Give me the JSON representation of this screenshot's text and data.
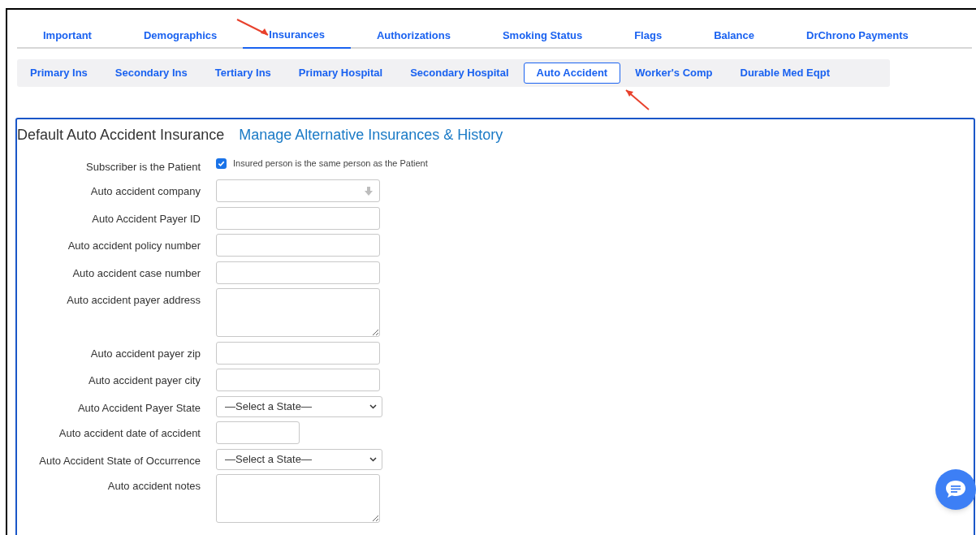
{
  "main_tabs": [
    {
      "label": "Important",
      "selected": false
    },
    {
      "label": "Demographics",
      "selected": false
    },
    {
      "label": "Insurances",
      "selected": true
    },
    {
      "label": "Authorizations",
      "selected": false
    },
    {
      "label": "Smoking Status",
      "selected": false
    },
    {
      "label": "Flags",
      "selected": false
    },
    {
      "label": "Balance",
      "selected": false
    },
    {
      "label": "DrChrono Payments",
      "selected": false
    }
  ],
  "sub_tabs": [
    {
      "label": "Primary Ins",
      "selected": false
    },
    {
      "label": "Secondary Ins",
      "selected": false
    },
    {
      "label": "Tertiary Ins",
      "selected": false
    },
    {
      "label": "Primary Hospital",
      "selected": false
    },
    {
      "label": "Secondary Hospital",
      "selected": false
    },
    {
      "label": "Auto Accident",
      "selected": true
    },
    {
      "label": "Worker's Comp",
      "selected": false
    },
    {
      "label": "Durable Med Eqpt",
      "selected": false
    }
  ],
  "form": {
    "title": "Default Auto Accident Insurance",
    "link": "Manage Alternative Insurances & History",
    "fields": [
      {
        "kind": "checkbox",
        "label": "Subscriber is the Patient",
        "checked": true,
        "text": "Insured person is the same person as the Patient"
      },
      {
        "kind": "combo",
        "label": "Auto accident company"
      },
      {
        "kind": "text",
        "label": "Auto Accident Payer ID"
      },
      {
        "kind": "text",
        "label": "Auto accident policy number"
      },
      {
        "kind": "text",
        "label": "Auto accident case number"
      },
      {
        "kind": "textarea",
        "label": "Auto accident payer address"
      },
      {
        "kind": "text",
        "label": "Auto accident payer zip"
      },
      {
        "kind": "text",
        "label": "Auto accident payer city"
      },
      {
        "kind": "select",
        "label": "Auto Accident Payer State",
        "value": "—Select a State—"
      },
      {
        "kind": "date",
        "label": "Auto accident date of accident"
      },
      {
        "kind": "select",
        "label": "Auto Accident State of Occurrence",
        "value": "—Select a State—"
      },
      {
        "kind": "textarea",
        "label": "Auto accident notes"
      }
    ]
  }
}
